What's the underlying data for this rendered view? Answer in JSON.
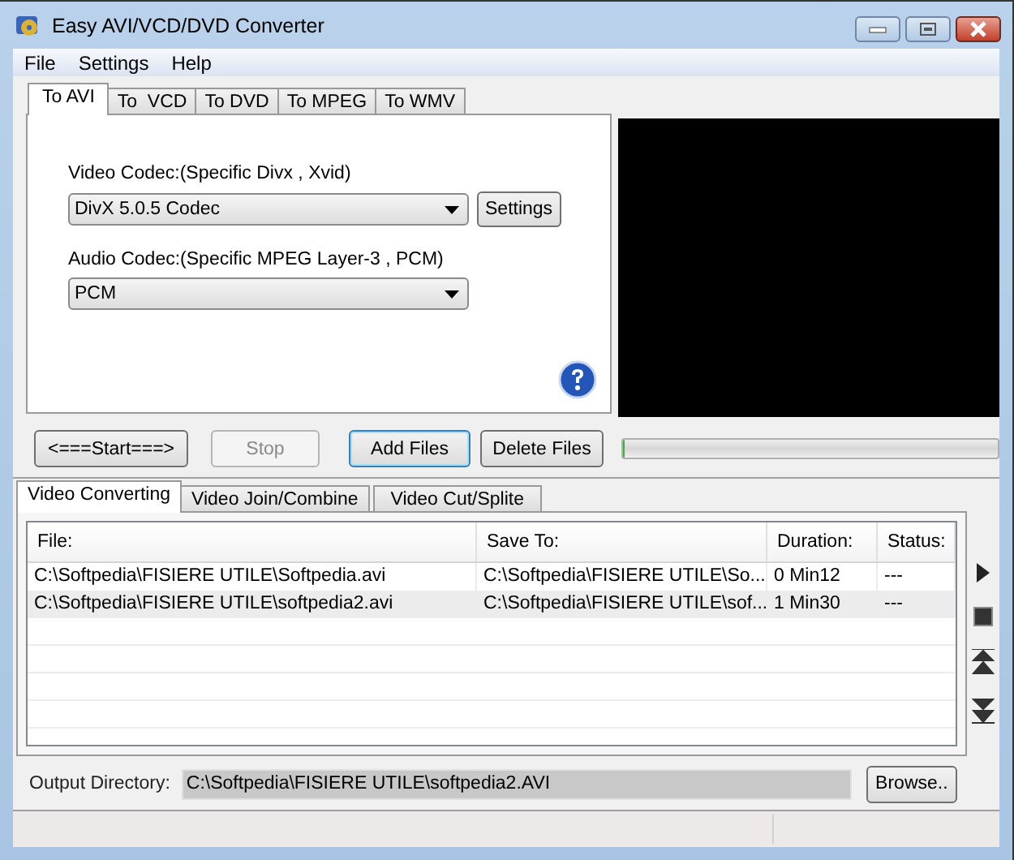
{
  "window": {
    "title": "Easy AVI/VCD/DVD Converter"
  },
  "menu": [
    "File",
    "Settings",
    "Help"
  ],
  "format_tabs": [
    {
      "label": "To AVI",
      "selected": true
    },
    {
      "label": "To  VCD",
      "selected": false
    },
    {
      "label": "To DVD",
      "selected": false
    },
    {
      "label": "To MPEG",
      "selected": false
    },
    {
      "label": "To WMV",
      "selected": false
    }
  ],
  "video_codec": {
    "label": "Video Codec:(Specific Divx , Xvid)",
    "value": "DivX 5.0.5 Codec",
    "settings_button": "Settings"
  },
  "audio_codec": {
    "label": "Audio Codec:(Specific MPEG Layer-3 , PCM)",
    "value": "PCM"
  },
  "buttons": [
    {
      "label": "<===Start===>",
      "disabled": false,
      "focused": false
    },
    {
      "label": "Stop",
      "disabled": true,
      "focused": false
    },
    {
      "label": "Add Files",
      "disabled": false,
      "focused": true
    },
    {
      "label": "Delete Files",
      "disabled": false,
      "focused": false
    }
  ],
  "progress": {
    "level": 0
  },
  "job_tabs": [
    {
      "label": "Video Converting",
      "selected": true
    },
    {
      "label": "Video Join/Combine",
      "selected": false
    },
    {
      "label": "Video Cut/Splite",
      "selected": false
    }
  ],
  "table": {
    "columns": [
      "File:",
      "Save To:",
      "Duration:",
      "Status:"
    ],
    "rows": [
      {
        "cells": [
          "C:\\Softpedia\\FISIERE UTILE\\Softpedia.avi",
          "C:\\Softpedia\\FISIERE UTILE\\So...",
          "0  Min12",
          "---"
        ],
        "selected": false
      },
      {
        "cells": [
          "C:\\Softpedia\\FISIERE UTILE\\softpedia2.avi",
          "C:\\Softpedia\\FISIERE UTILE\\sof...",
          "1  Min30",
          "---"
        ],
        "selected": true
      }
    ]
  },
  "output": {
    "label": "Output Directory:",
    "value": "C:\\Softpedia\\FISIERE UTILE\\softpedia2.AVI",
    "browse_button": "Browse.."
  }
}
